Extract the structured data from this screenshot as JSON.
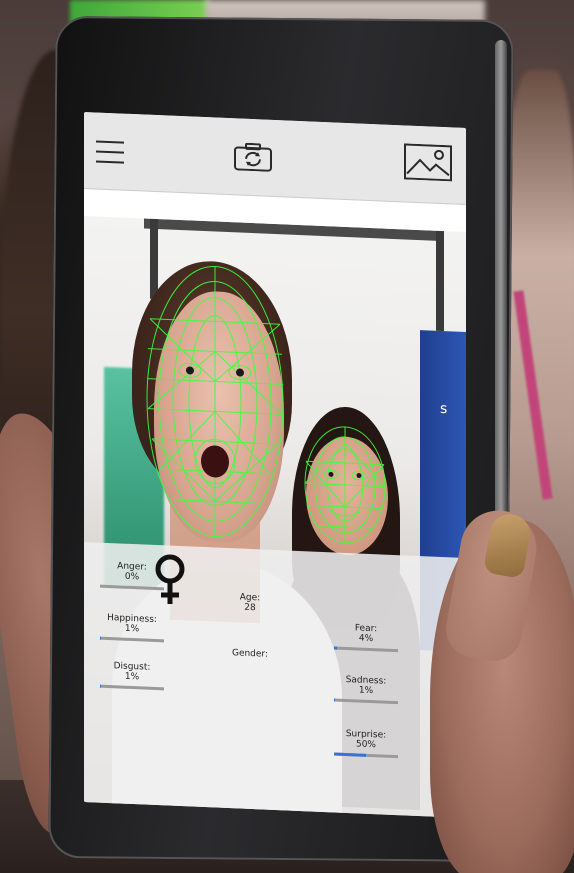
{
  "app": {
    "toolbar": {
      "menu_icon": "hamburger-menu-icon",
      "camera_icon": "camera-switch-icon",
      "gallery_icon": "image-gallery-icon"
    },
    "video": {
      "banner_text": "s"
    },
    "stats": {
      "anger": {
        "label": "Anger:",
        "value": "0%",
        "level": 0
      },
      "happiness": {
        "label": "Happiness:",
        "value": "1%",
        "level": 0.01
      },
      "disgust": {
        "label": "Disgust:",
        "value": "1%",
        "level": 0.01
      },
      "age": {
        "label": "Age:",
        "value": "28"
      },
      "gender": {
        "label": "Gender:",
        "icon": "female-symbol-icon"
      },
      "fear": {
        "label": "Fear:",
        "value": "4%",
        "level": 0.04
      },
      "sadness": {
        "label": "Sadness:",
        "value": "1%",
        "level": 0.01
      },
      "surprise": {
        "label": "Surprise:",
        "value": "50%",
        "level": 0.5
      }
    },
    "colors": {
      "mesh": "#3cff3c",
      "bar_fill": "#3a73d6",
      "bar_track": "#9a9a9a",
      "toolbar_bg": "#e7e7e7"
    }
  }
}
